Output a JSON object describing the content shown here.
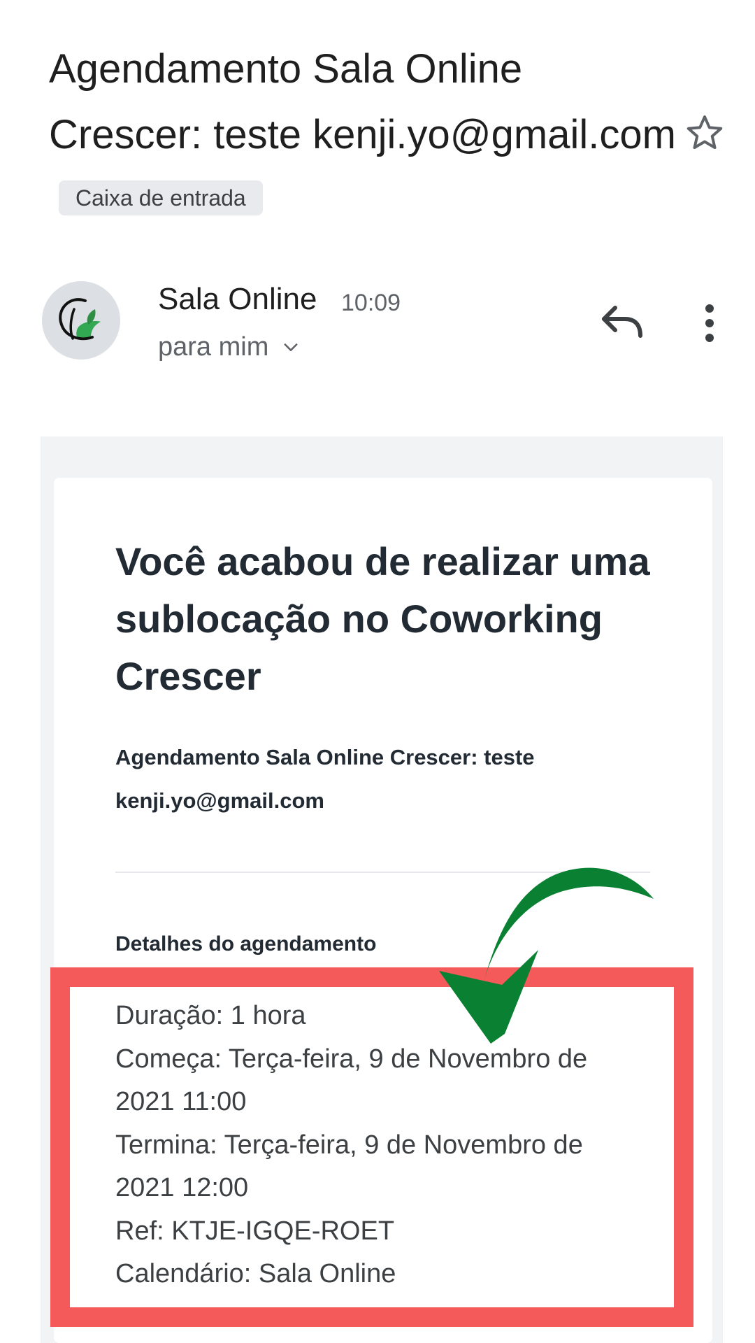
{
  "email": {
    "subject": "Agendamento Sala Online Crescer: teste kenji.yo@gmail.com",
    "label": "Caixa de entrada",
    "sender": "Sala Online",
    "time": "10:09",
    "recipient": "para mim"
  },
  "icons": {
    "star": "star-outline-icon",
    "reply": "reply-icon",
    "more": "more-vert-icon",
    "expand": "chevron-down-icon",
    "arrow": "curved-arrow-annotation"
  },
  "body": {
    "headline": "Você acabou de realizar uma sublocação no Coworking Crescer",
    "subline": "Agendamento Sala Online Crescer: teste kenji.yo@gmail.com",
    "details_title": "Detalhes do agendamento",
    "details": [
      "Duração: 1 hora",
      "Começa: Terça-feira, 9 de Novembro de 2021 11:00",
      "Termina: Terça-feira, 9 de Novembro de 2021 12:00",
      "Ref: KTJE-IGQE-ROET",
      "Calendário: Sala Online"
    ]
  },
  "colors": {
    "highlight_box": "#f55a5a",
    "arrow": "#0a8033",
    "card_background": "#f1f3f4"
  }
}
